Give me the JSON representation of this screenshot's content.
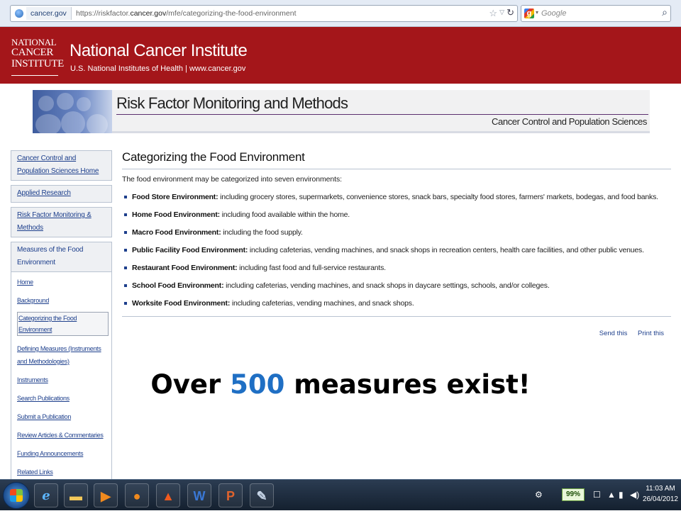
{
  "browser": {
    "site_identity": "cancer.gov",
    "url_prefix": "https://riskfactor.",
    "url_domain": "cancer.gov",
    "url_path": "/mfe/categorizing-the-food-environment",
    "search_placeholder": "Google"
  },
  "header": {
    "logo_lines": [
      "NATIONAL",
      "CANCER",
      "INSTITUTE"
    ],
    "title": "National Cancer Institute",
    "subtitle": "U.S. National Institutes of Health | www.cancer.gov"
  },
  "banner": {
    "title": "Risk Factor Monitoring and Methods",
    "subtitle": "Cancer Control and Population Sciences"
  },
  "sidebar": {
    "boxes": [
      "Cancer Control and Population Sciences Home",
      "Applied Research",
      "Risk Factor Monitoring & Methods"
    ],
    "group_title": "Measures of the Food Environment",
    "items": [
      "Home",
      "Background",
      "Categorizing the Food Environment",
      "Defining Measures (Instruments and Methodologies)",
      "Instruments",
      "Search Publications",
      "Submit a Publication",
      "Review Articles & Commentaries",
      "Funding Announcements",
      "Related Links"
    ]
  },
  "main": {
    "title": "Categorizing the Food Environment",
    "intro": "The food environment may be categorized into seven environments:",
    "environments": [
      {
        "name": "Food Store Environment:",
        "desc": " including grocery stores, supermarkets, convenience stores, snack bars, specialty food stores, farmers' markets, bodegas, and food banks."
      },
      {
        "name": "Home Food Environment:",
        "desc": " including food available within the home."
      },
      {
        "name": "Macro Food Environment:",
        "desc": " including the food supply."
      },
      {
        "name": "Public Facility Food Environment:",
        "desc": " including cafeterias, vending machines, and snack shops in recreation centers, health care facilities, and other public venues."
      },
      {
        "name": "Restaurant Food Environment:",
        "desc": " including fast food and full-service restaurants."
      },
      {
        "name": "School Food Environment:",
        "desc": " including cafeterias, vending machines, and snack shops in daycare settings, schools, and/or colleges."
      },
      {
        "name": "Worksite Food Environment:",
        "desc": " including cafeterias, vending machines, and snack shops."
      }
    ],
    "actions": [
      "Send this",
      "Print this"
    ]
  },
  "overlay": {
    "before": "Over ",
    "highlight": "500",
    "after": " measures exist!",
    "highlight_color": "#1f6fc4"
  },
  "taskbar": {
    "battery": "99%",
    "time": "11:03 AM",
    "date": "26/04/2012",
    "pinned_icons": [
      "ie-icon",
      "explorer-icon",
      "media-player-icon",
      "firefox-icon",
      "app-icon",
      "word-icon",
      "powerpoint-icon",
      "tools-icon"
    ]
  },
  "colors": {
    "header_red": "#a4161a",
    "link_blue": "#1d3f8c"
  }
}
